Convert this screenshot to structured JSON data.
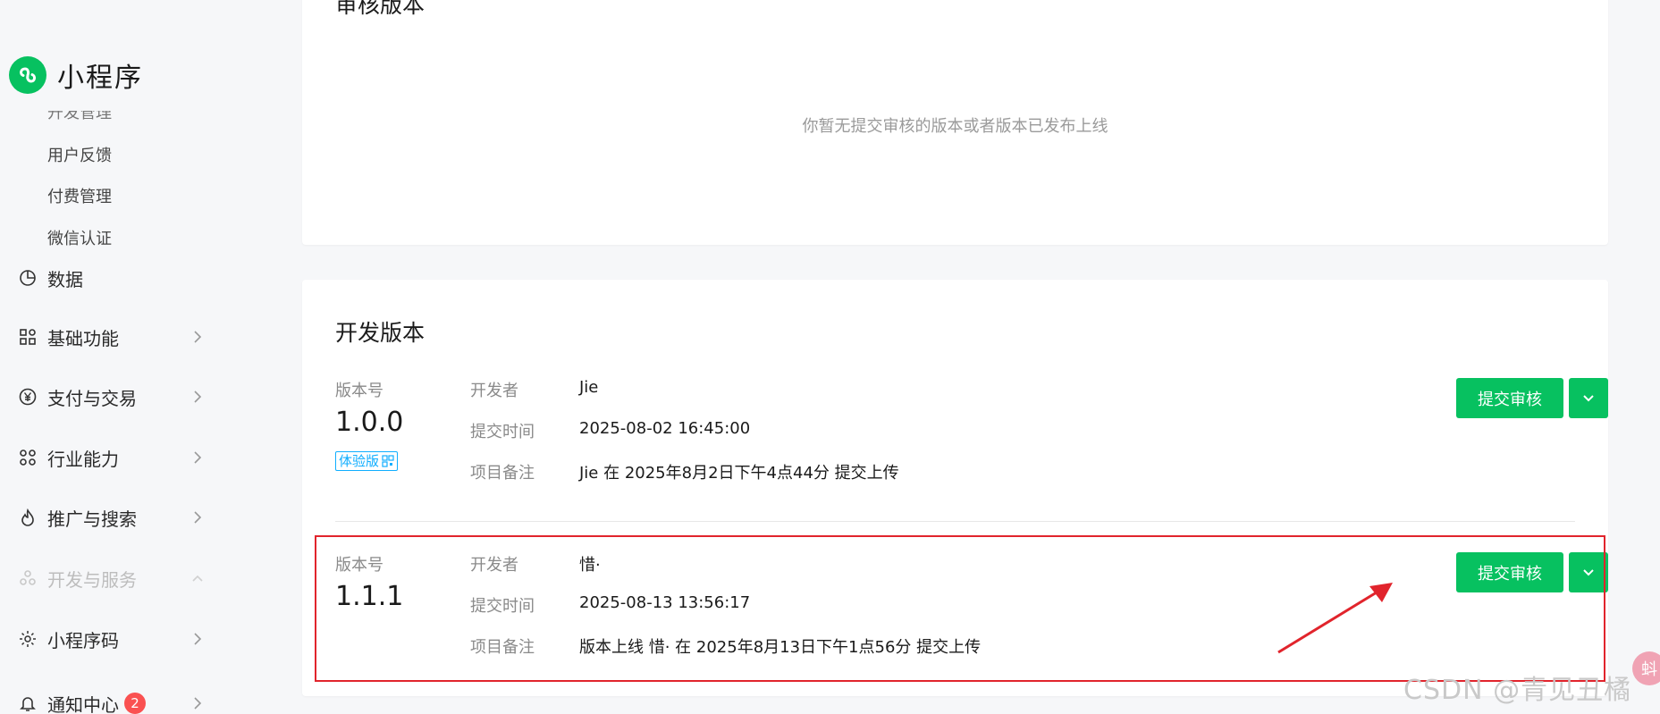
{
  "app": {
    "title": "小程序",
    "accent": "#07c160"
  },
  "sidebar": {
    "cut_item": "开发管理",
    "sub_items": [
      {
        "label": "用户反馈"
      },
      {
        "label": "付费管理"
      },
      {
        "label": "微信认证"
      }
    ],
    "nav_items": [
      {
        "label": "数据",
        "icon": "pie-chart-icon"
      },
      {
        "label": "基础功能",
        "icon": "grid-icon"
      },
      {
        "label": "支付与交易",
        "icon": "yuan-icon"
      },
      {
        "label": "行业能力",
        "icon": "nodes-icon"
      },
      {
        "label": "推广与搜索",
        "icon": "flame-icon"
      },
      {
        "label": "开发与服务",
        "icon": "cluster-icon"
      },
      {
        "label": "小程序码",
        "icon": "sun-code-icon"
      },
      {
        "label": "通知中心",
        "icon": "bell-icon",
        "badge": "2"
      }
    ]
  },
  "review_section": {
    "title": "审核版本",
    "empty_text": "你暂无提交审核的版本或者版本已发布上线"
  },
  "dev_section": {
    "title": "开发版本",
    "versions": [
      {
        "version_label": "版本号",
        "version": "1.0.0",
        "tag": "体验版",
        "developer_key": "开发者",
        "developer": "Jie",
        "time_key": "提交时间",
        "time": "2025-08-02 16:45:00",
        "note_key": "项目备注",
        "note": "Jie 在 2025年8月2日下午4点44分 提交上传",
        "submit_label": "提交审核"
      },
      {
        "version_label": "版本号",
        "version": "1.1.1",
        "developer_key": "开发者",
        "developer": "惜·",
        "time_key": "提交时间",
        "time": "2025-08-13 13:56:17",
        "note_key": "项目备注",
        "note": "版本上线 惜· 在 2025年8月13日下午1点56分 提交上传",
        "submit_label": "提交审核"
      }
    ]
  },
  "overlay": {
    "watermark": "CSDN @青见丑橘",
    "float_ball": "蚪",
    "highlight_color": "#e1242c"
  }
}
